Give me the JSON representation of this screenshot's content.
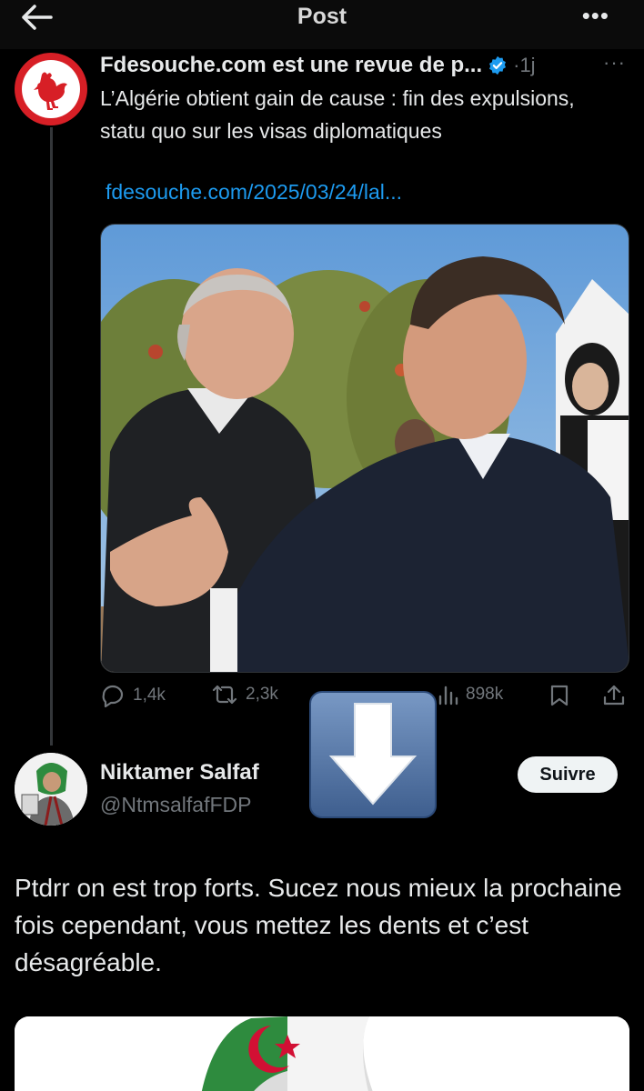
{
  "topbar": {
    "title": "Post"
  },
  "icons": {
    "back": "arrow-left-icon",
    "more": "more-horizontal-icon"
  },
  "tweet1": {
    "author": "Fdesouche.com est une revue de p...",
    "time": "·1j",
    "more": "···",
    "text": "L’Algérie obtient gain de cause : fin des expulsions, statu quo sur les visas diplomatiques",
    "link": "fdesouche.com/2025/03/24/lal...",
    "stats": {
      "replies": "1,4k",
      "reposts": "2,3k",
      "views": "898k"
    }
  },
  "reply": {
    "author": "Niktamer Salfaf",
    "handle": "@NtmsalfafFDP",
    "follow_label": "Suivre",
    "text": "Ptdrr on est trop forts. Sucez nous mieux la prochaine fois cependant, vous mettez les dents et c’est désagréable."
  },
  "colors": {
    "background": "#000000",
    "accent": "#1d9bf0",
    "muted": "#71767b",
    "avatar_red": "#d71f26"
  }
}
